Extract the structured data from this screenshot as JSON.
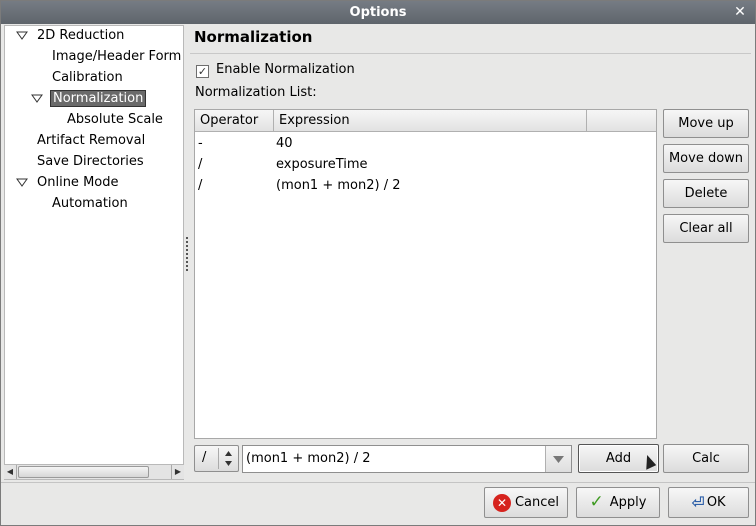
{
  "window": {
    "title": "Options"
  },
  "tree": {
    "items": [
      {
        "label": "2D Reduction",
        "level": 0,
        "expanded": true
      },
      {
        "label": "Image/Header Form",
        "level": 1
      },
      {
        "label": "Calibration",
        "level": 1
      },
      {
        "label": "Normalization",
        "level": 1,
        "expanded": true,
        "selected": true
      },
      {
        "label": "Absolute Scale",
        "level": 2
      },
      {
        "label": "Artifact Removal",
        "level": 0
      },
      {
        "label": "Save Directories",
        "level": 0
      },
      {
        "label": "Online Mode",
        "level": 0,
        "expanded": true
      },
      {
        "label": "Automation",
        "level": 1
      }
    ]
  },
  "page": {
    "title": "Normalization",
    "enable_label": "Enable Normalization",
    "enable_checked": true,
    "list_label": "Normalization List:"
  },
  "table": {
    "columns": [
      "Operator",
      "Expression",
      ""
    ],
    "rows": [
      {
        "operator": "-",
        "expression": "40"
      },
      {
        "operator": "/",
        "expression": "exposureTime"
      },
      {
        "operator": "/",
        "expression": "(mon1 + mon2) / 2"
      }
    ]
  },
  "side_buttons": {
    "move_up": "Move up",
    "move_down": "Move down",
    "delete": "Delete",
    "clear_all": "Clear all"
  },
  "editor": {
    "operator_value": "/",
    "expression_value": "(mon1 + mon2) / 2",
    "add_label": "Add",
    "calc_label": "Calc"
  },
  "footer": {
    "cancel_label": "Cancel",
    "apply_label": "Apply",
    "ok_label": "OK"
  },
  "colors": {
    "titlebar": "#6a7078",
    "selection": "#6a6a6a",
    "cancel_icon": "#d6231e",
    "apply_icon": "#3d9a20"
  }
}
